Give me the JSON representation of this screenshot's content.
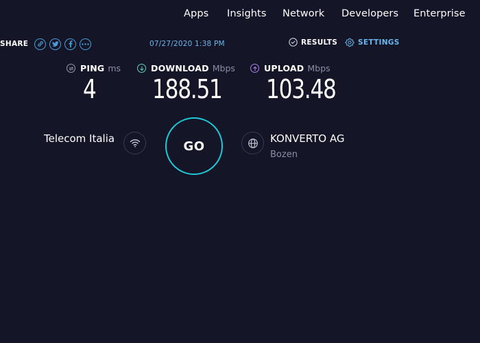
{
  "nav": {
    "items": [
      "Apps",
      "Insights",
      "Network",
      "Developers",
      "Enterprise"
    ]
  },
  "share": {
    "label": "SHARE",
    "icons": [
      "link-icon",
      "twitter-icon",
      "facebook-icon",
      "more-icon"
    ]
  },
  "result": {
    "datetime": "07/27/2020 1:38 PM",
    "results_label": "RESULTS",
    "settings_label": "SETTINGS"
  },
  "metrics": {
    "ping": {
      "label": "PING",
      "unit": "ms",
      "value": "4"
    },
    "download": {
      "label": "DOWNLOAD",
      "unit": "Mbps",
      "value": "188.51"
    },
    "upload": {
      "label": "UPLOAD",
      "unit": "Mbps",
      "value": "103.48"
    }
  },
  "connection": {
    "isp": "Telecom Italia",
    "go_label": "GO",
    "server_name": "KONVERTO AG",
    "server_location": "Bozen"
  },
  "colors": {
    "background": "#141526",
    "accent_blue": "#6ab7ee",
    "go_ring": "#1ec9d8",
    "download_icon": "#5fd3c6",
    "upload_icon": "#b27ef0",
    "muted_text": "#8d8da6"
  }
}
